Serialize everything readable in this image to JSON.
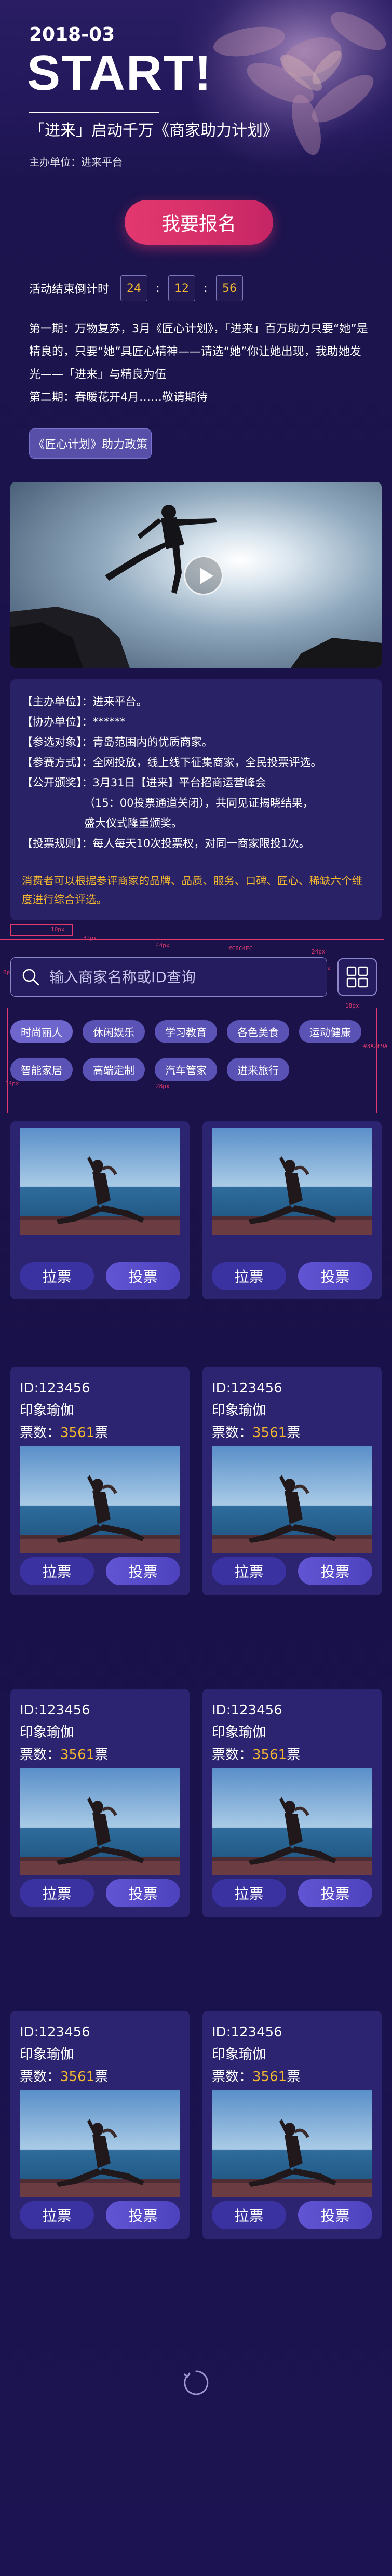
{
  "hero": {
    "date": "2018-03",
    "start": "START!",
    "subtitle": "「进来」启动千万《商家助力计划》",
    "organizer": "主办单位：进来平台"
  },
  "signup_button": "我要报名",
  "countdown": {
    "label": "活动结束倒计时",
    "days": "24",
    "hours": "12",
    "minutes": "56"
  },
  "intro": {
    "phase1": "第一期：万物复苏，3月《匠心计划》，「进来」百万助力只要“她”是精良的，只要“她”具匠心精神——请选“她”你让她出现，我助她发光——「进来」与精良为伍",
    "phase2": "第二期：春暖花开4月……敬请期待"
  },
  "policy_button": "《匠心计划》助力政策",
  "video": {
    "play_icon": "play-icon"
  },
  "info": {
    "rows": [
      {
        "key": "【主办单位】：",
        "value": "进来平台。"
      },
      {
        "key": "【协办单位】：",
        "value": "******"
      },
      {
        "key": "【参选对象】：",
        "value": "青岛范围内的优质商家。"
      },
      {
        "key": "【参赛方式】：",
        "value": "全网投放，线上线下征集商家，全民投票评选。"
      },
      {
        "key": "【公开颁奖】：",
        "value": "3月31日【进来】平台招商运营峰会"
      }
    ],
    "award_extra_1": "（15：00投票通道关闭），共同见证揭晓结果，",
    "award_extra_2": "盛大仪式隆重颁奖。",
    "vote_rule_key": "【投票规则】：",
    "vote_rule_value": "每人每天10次投票权，对同一商家限投1次。",
    "note": "消费者可以根据参评商家的品牌、品质、服务、口碑、匠心、稀缺六个维度进行综合评选。"
  },
  "annotations": {
    "a1": "10px",
    "a2": "32px",
    "a3": "44px",
    "a4": "#C8C4EC",
    "a5": "24px",
    "a6": "6px",
    "a7": "20px",
    "a8": "18px",
    "a9": "#3A2F9A",
    "a10": "14px",
    "a11": "28px"
  },
  "search": {
    "placeholder": "输入商家名称或ID查询"
  },
  "tags": {
    "row1": [
      "时尚丽人",
      "休闲娱乐",
      "学习教育",
      "各色美食",
      "运动健康"
    ],
    "row2": [
      "智能家居",
      "高端定制",
      "汽车管家",
      "进来旅行"
    ]
  },
  "cards": [
    {
      "show_meta": false,
      "id": "",
      "name": "",
      "votes_label": "",
      "votes": "",
      "unit": "",
      "cast_label": "拉票",
      "vote_label": "投票"
    },
    {
      "show_meta": false,
      "id": "",
      "name": "",
      "votes_label": "",
      "votes": "",
      "unit": "",
      "cast_label": "拉票",
      "vote_label": "投票"
    },
    {
      "show_meta": true,
      "id": "ID:123456",
      "name": "印象瑜伽",
      "votes_label": "票数：",
      "votes": "3561",
      "unit": "票",
      "cast_label": "拉票",
      "vote_label": "投票"
    },
    {
      "show_meta": true,
      "id": "ID:123456",
      "name": "印象瑜伽",
      "votes_label": "票数：",
      "votes": "3561",
      "unit": "票",
      "cast_label": "拉票",
      "vote_label": "投票"
    },
    {
      "show_meta": true,
      "id": "ID:123456",
      "name": "印象瑜伽",
      "votes_label": "票数：",
      "votes": "3561",
      "unit": "票",
      "cast_label": "拉票",
      "vote_label": "投票"
    },
    {
      "show_meta": true,
      "id": "ID:123456",
      "name": "印象瑜伽",
      "votes_label": "票数：",
      "votes": "3561",
      "unit": "票",
      "cast_label": "拉票",
      "vote_label": "投票"
    },
    {
      "show_meta": true,
      "id": "ID:123456",
      "name": "印象瑜伽",
      "votes_label": "票数：",
      "votes": "3561",
      "unit": "票",
      "cast_label": "拉票",
      "vote_label": "投票"
    },
    {
      "show_meta": true,
      "id": "ID:123456",
      "name": "印象瑜伽",
      "votes_label": "票数：",
      "votes": "3561",
      "unit": "票",
      "cast_label": "拉票",
      "vote_label": "投票"
    }
  ],
  "colors": {
    "accent_pink": "#d8306a",
    "gold": "#f5b82e",
    "tag_bg": "#5a52b5",
    "card_bg": "#2c2470"
  },
  "loading_icon": "loading-spinner-icon"
}
